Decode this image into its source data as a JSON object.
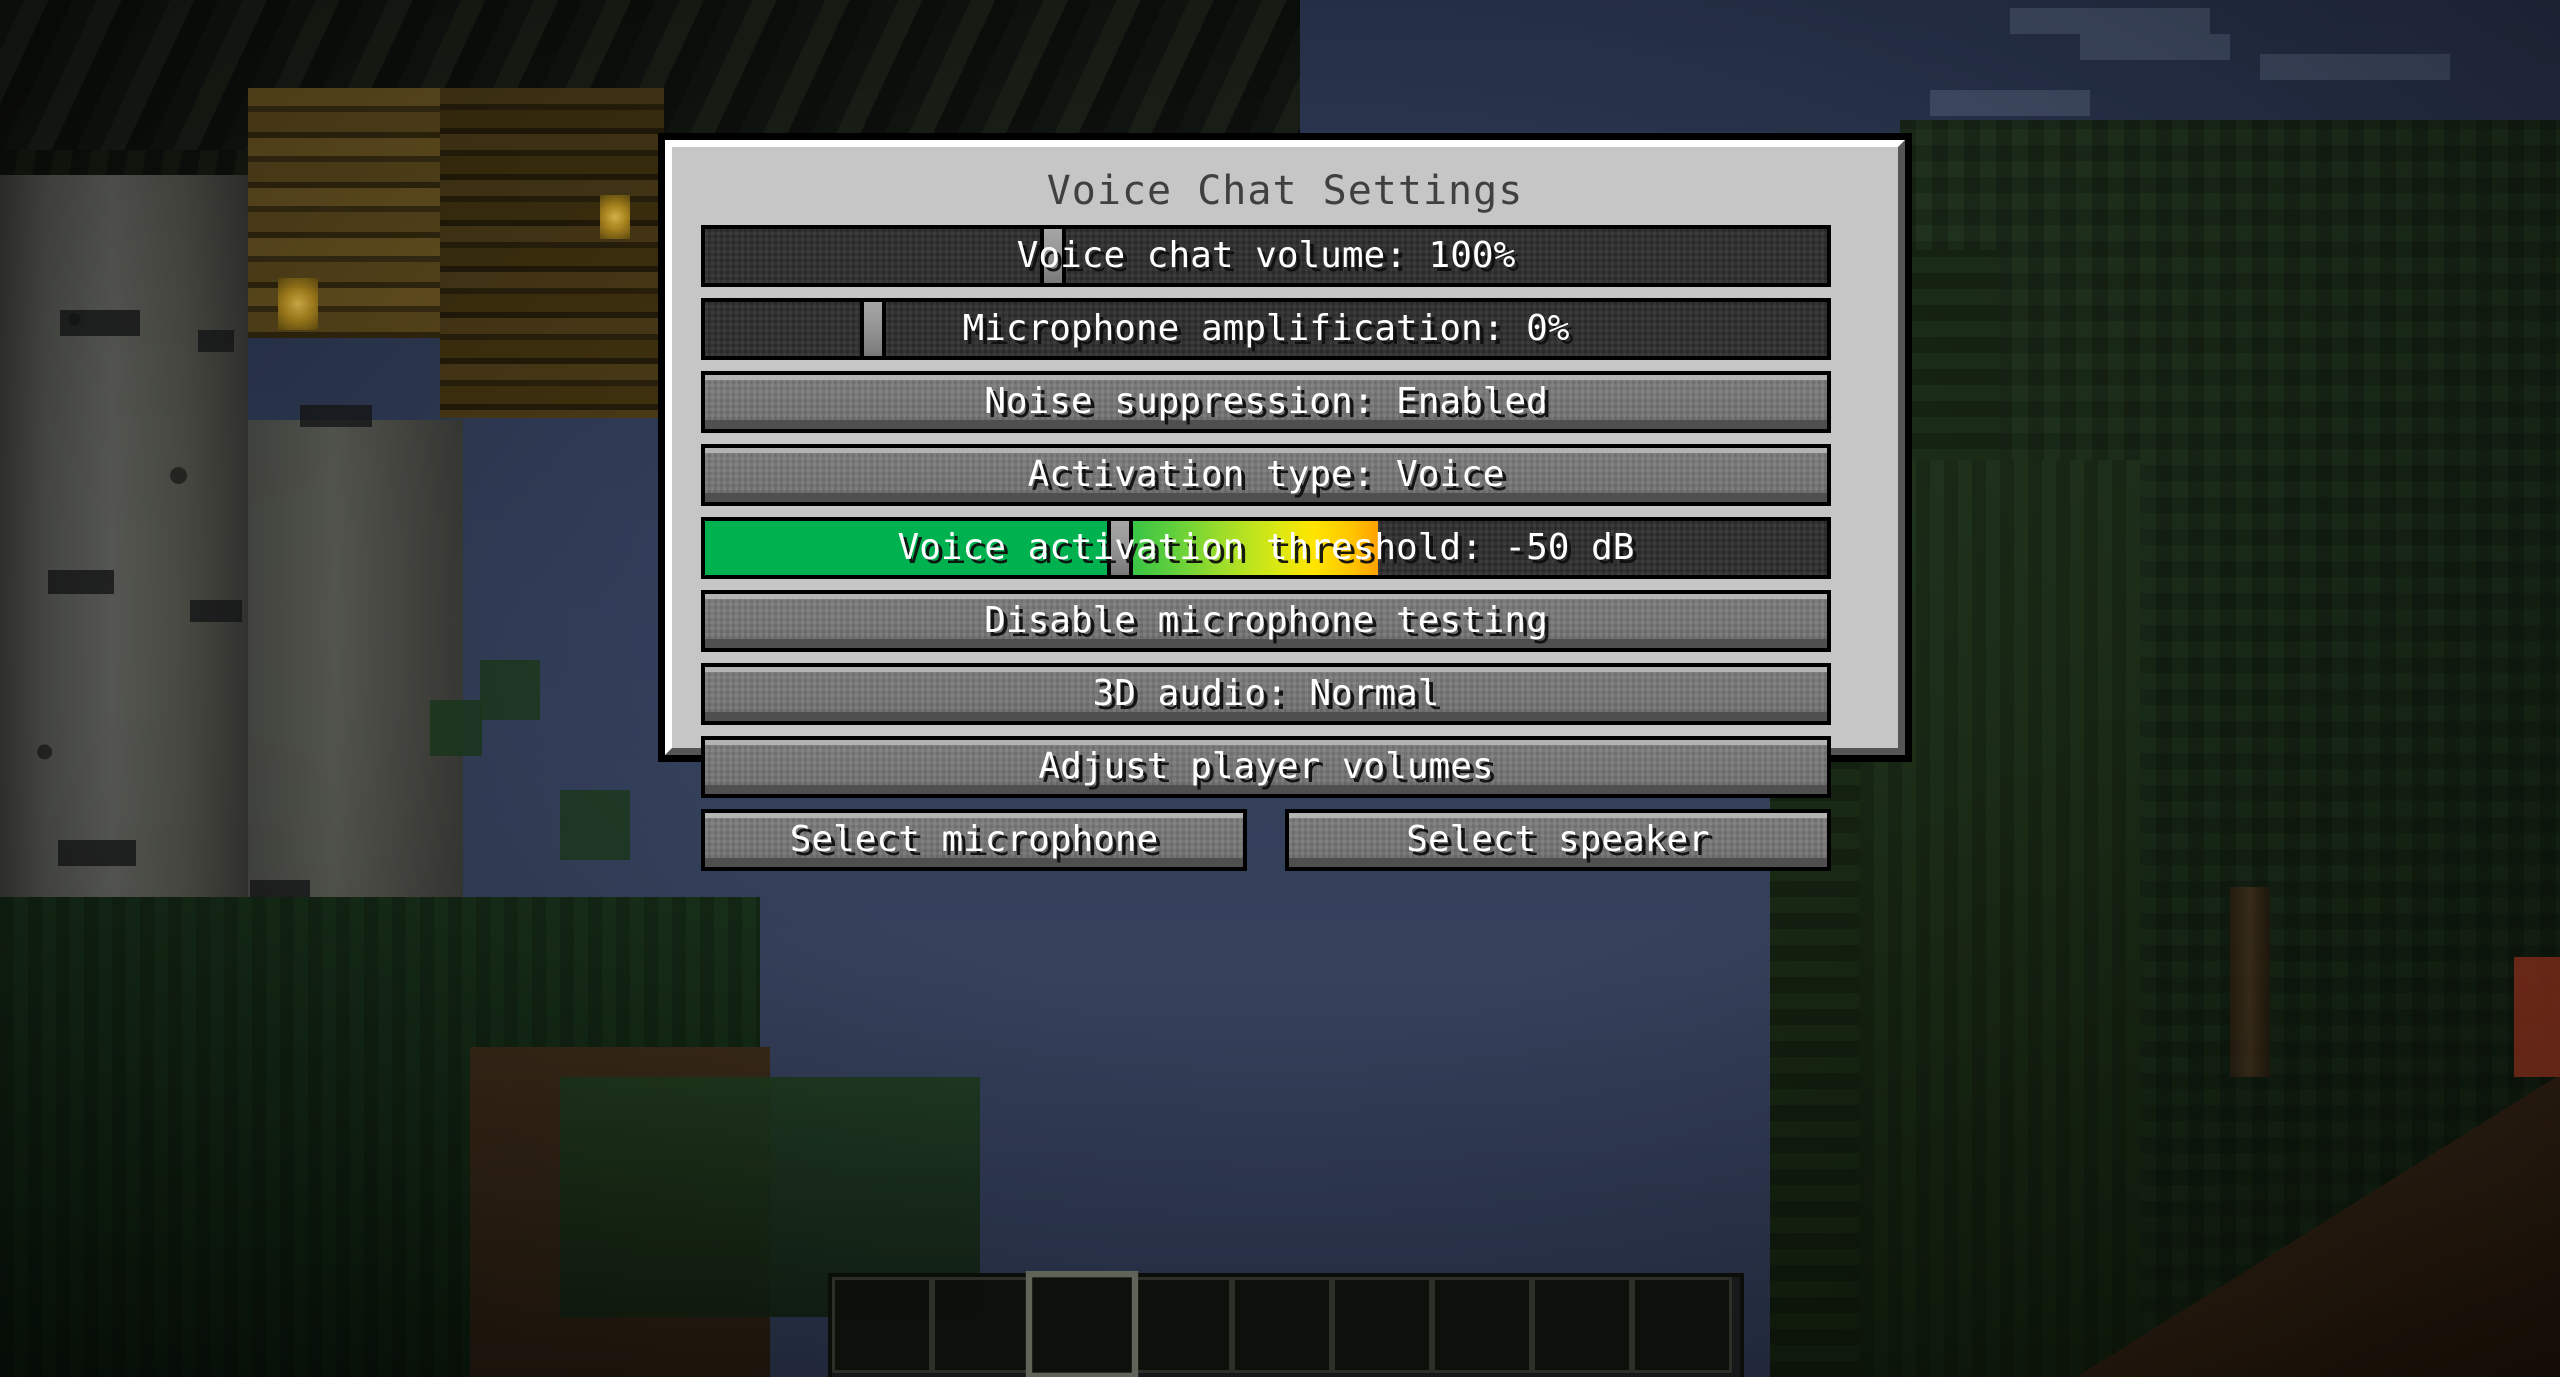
{
  "window": {
    "title": "Voice Chat Settings"
  },
  "panel": {
    "title": "Voice Chat Settings",
    "rows": [
      {
        "name": "voice-chat-volume-slider",
        "type": "slider",
        "label": "Voice chat volume: 100%",
        "setting": "Voice chat volume",
        "value": "100%",
        "handle_percent": 31
      },
      {
        "name": "microphone-amplification-slider",
        "type": "slider",
        "label": "Microphone amplification: 0%",
        "setting": "Microphone amplification",
        "value": "0%",
        "handle_percent": 15
      },
      {
        "name": "noise-suppression-button",
        "type": "button",
        "label": "Noise suppression: Enabled",
        "setting": "Noise suppression",
        "value": "Enabled"
      },
      {
        "name": "activation-type-button",
        "type": "button",
        "label": "Activation type: Voice",
        "setting": "Activation type",
        "value": "Voice"
      },
      {
        "name": "voice-activation-threshold-slider",
        "type": "meter-slider",
        "label": "Voice activation threshold: -50 dB",
        "setting": "Voice activation threshold",
        "value": "-50 dB",
        "handle_percent": 37,
        "meter_percent": 60,
        "colors": {
          "solid": "#00b14f",
          "gradient_start": "#2ec14a",
          "gradient_mid": "#ffe500",
          "gradient_end": "#ffa200",
          "track": "#2e2e2e"
        }
      },
      {
        "name": "disable-microphone-testing-button",
        "type": "button",
        "label": "Disable microphone testing"
      },
      {
        "name": "3d-audio-button",
        "type": "button",
        "label": "3D audio: Normal",
        "setting": "3D audio",
        "value": "Normal"
      },
      {
        "name": "adjust-player-volumes-button",
        "type": "button",
        "label": "Adjust player volumes"
      }
    ],
    "bottom_row": [
      {
        "name": "select-microphone-button",
        "label": "Select microphone"
      },
      {
        "name": "select-speaker-button",
        "label": "Select speaker"
      }
    ]
  },
  "hud": {
    "hotbar": {
      "slot_count": 9,
      "selected_slot": 3
    }
  },
  "theme": {
    "panel_background": "#c6c6c6",
    "panel_highlight": "#ffffff",
    "panel_shadow": "#555555",
    "button_face": "#757575",
    "slider_track": "#2e2e2e",
    "title_color": "#404040",
    "label_color": "#ffffff"
  }
}
